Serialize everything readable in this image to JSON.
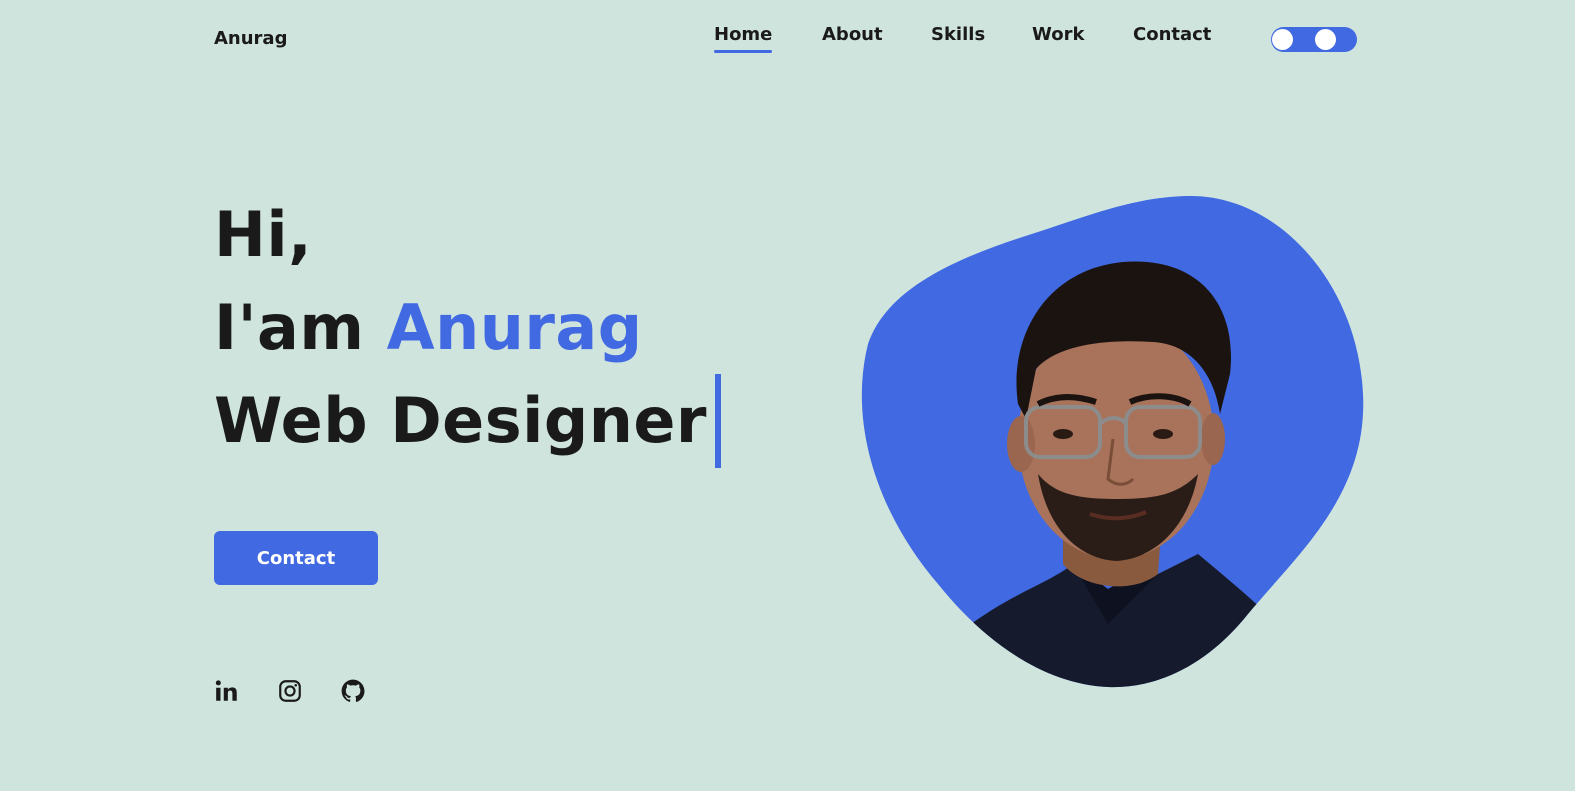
{
  "header": {
    "logo": "Anurag",
    "nav": [
      {
        "label": "Home",
        "active": true
      },
      {
        "label": "About",
        "active": false
      },
      {
        "label": "Skills",
        "active": false
      },
      {
        "label": "Work",
        "active": false
      },
      {
        "label": "Contact",
        "active": false
      }
    ],
    "theme_toggle": {
      "icon": "toggle-icon"
    }
  },
  "hero": {
    "greeting": "Hi,",
    "intro_prefix": "I'am",
    "name": "Anurag",
    "role": "Web Designer",
    "cta_label": "Contact"
  },
  "socials": [
    {
      "icon": "linkedin-icon"
    },
    {
      "icon": "instagram-icon"
    },
    {
      "icon": "github-icon"
    }
  ],
  "colors": {
    "background": "#d0e4de",
    "accent": "#4169e1",
    "text": "#1a1a1a"
  }
}
